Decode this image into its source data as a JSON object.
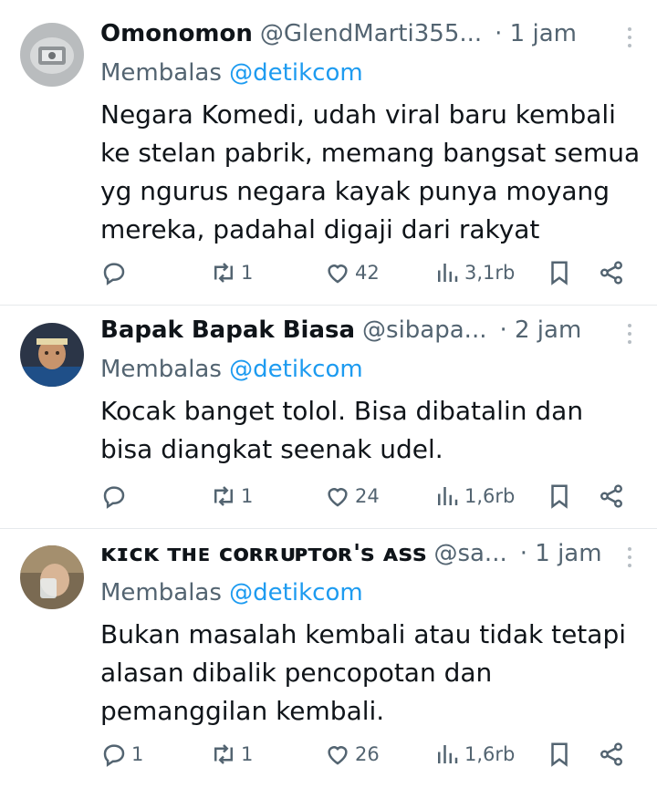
{
  "tweets": [
    {
      "name": "Omonomon",
      "handle": "@GlendMarti355...",
      "time": "· 1 jam",
      "reply_prefix": "Membalas",
      "reply_mention": "@detikcom",
      "text": "Negara Komedi, udah viral baru kembali ke stelan pabrik, memang bangsat semua yg ngurus negara kayak punya moyang mereka, padahal digaji dari rakyat",
      "replies": "",
      "retweets": "1",
      "likes": "42",
      "views": "3,1rb"
    },
    {
      "name": "Bapak Bapak Biasa",
      "handle": "@sibapa...",
      "time": "· 2 jam",
      "reply_prefix": "Membalas",
      "reply_mention": "@detikcom",
      "text": "Kocak banget tolol. Bisa dibatalin dan bisa diangkat seenak udel.",
      "replies": "",
      "retweets": "1",
      "likes": "24",
      "views": "1,6rb"
    },
    {
      "name": "ᴋɪᴄᴋ ᴛʜᴇ ᴄᴏʀʀᴜᴘᴛᴏʀ's ᴀss",
      "handle": "@sa...",
      "time": "· 1 jam",
      "reply_prefix": "Membalas",
      "reply_mention": "@detikcom",
      "text": "Bukan masalah kembali atau tidak tetapi alasan dibalik pencopotan dan pemanggilan kembali.",
      "replies": "1",
      "retweets": "1",
      "likes": "26",
      "views": "1,6rb"
    }
  ],
  "colors": {
    "text": "#0f1419",
    "secondary": "#536471",
    "mention": "#1d9bf0",
    "divider": "#e6e9ec"
  }
}
